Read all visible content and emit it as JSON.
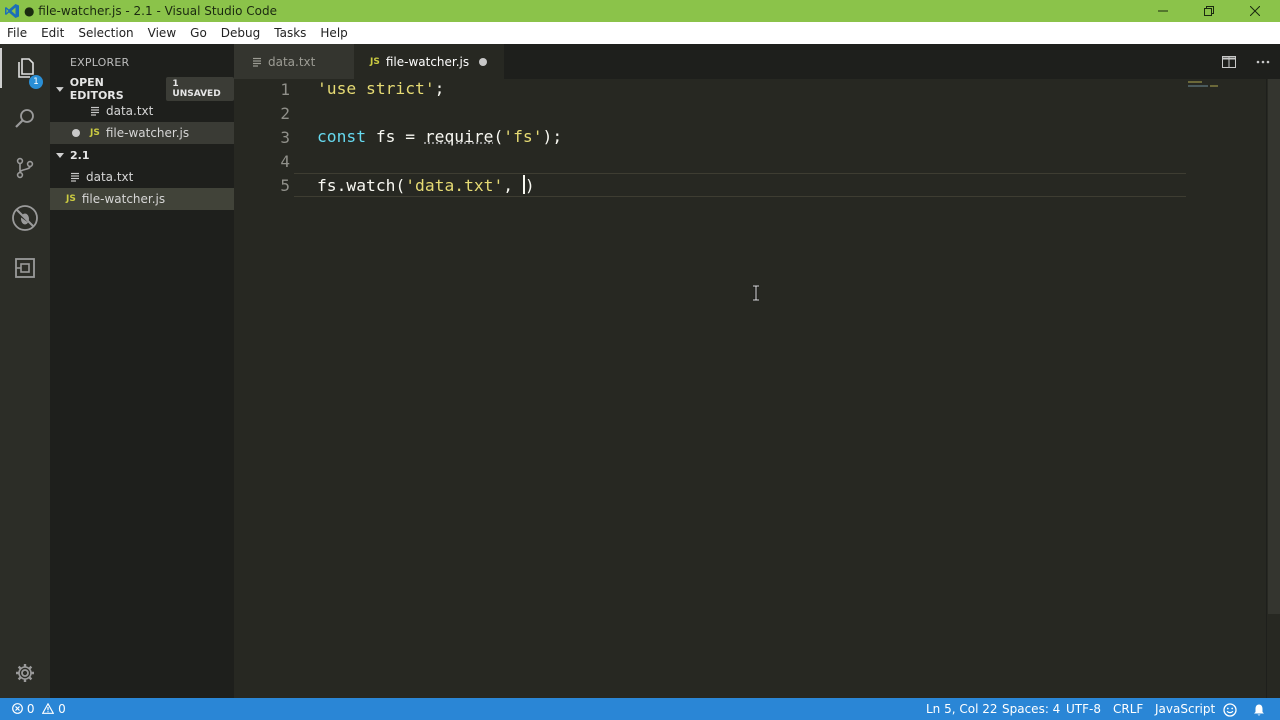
{
  "window": {
    "title": "● file-watcher.js - 2.1 - Visual Studio Code"
  },
  "menu": [
    "File",
    "Edit",
    "Selection",
    "View",
    "Go",
    "Debug",
    "Tasks",
    "Help"
  ],
  "activity_bar": {
    "explorer_badge": "1",
    "icons": [
      "files-icon",
      "search-icon",
      "source-control-icon",
      "debug-icon",
      "extensions-icon",
      "gear-icon"
    ]
  },
  "sidebar": {
    "title": "EXPLORER",
    "open_editors": {
      "label": "OPEN EDITORS",
      "badge": "1 UNSAVED",
      "items": [
        {
          "name": "data.txt",
          "type": "txt",
          "dirty": false
        },
        {
          "name": "file-watcher.js",
          "type": "js",
          "dirty": true
        }
      ]
    },
    "folder": {
      "label": "2.1",
      "items": [
        {
          "name": "data.txt",
          "type": "txt"
        },
        {
          "name": "file-watcher.js",
          "type": "js"
        }
      ]
    },
    "js_glyph": "JS"
  },
  "tabs": [
    {
      "label": "data.txt",
      "active": false,
      "icon": "txt"
    },
    {
      "label": "file-watcher.js",
      "active": true,
      "dirty": true,
      "icon": "js"
    }
  ],
  "editor": {
    "line_numbers": [
      "1",
      "2",
      "3",
      "4",
      "5"
    ],
    "lines": {
      "l1": {
        "str": "'use strict'",
        "tail": ";"
      },
      "l3": {
        "kw": "const",
        "var": " fs ",
        "eq": "=",
        "sp": " ",
        "fn": "require",
        "open": "(",
        "str": "'fs'",
        "close": ");"
      },
      "l5": {
        "obj": "fs",
        "dot": ".",
        "fn": "watch",
        "open": "(",
        "str": "'data.txt'",
        "comma": ", ",
        "close": ")"
      }
    }
  },
  "status": {
    "errors": "0",
    "warnings": "0",
    "position": "Ln 5, Col 22",
    "spaces": "Spaces: 4",
    "encoding": "UTF-8",
    "eol": "CRLF",
    "language": "JavaScript"
  },
  "colors": {
    "title_bar": "#8bc34a",
    "status_bar": "#2a86d6",
    "editor_bg": "#272822",
    "string": "#e6db74",
    "keyword": "#66d9ef"
  }
}
